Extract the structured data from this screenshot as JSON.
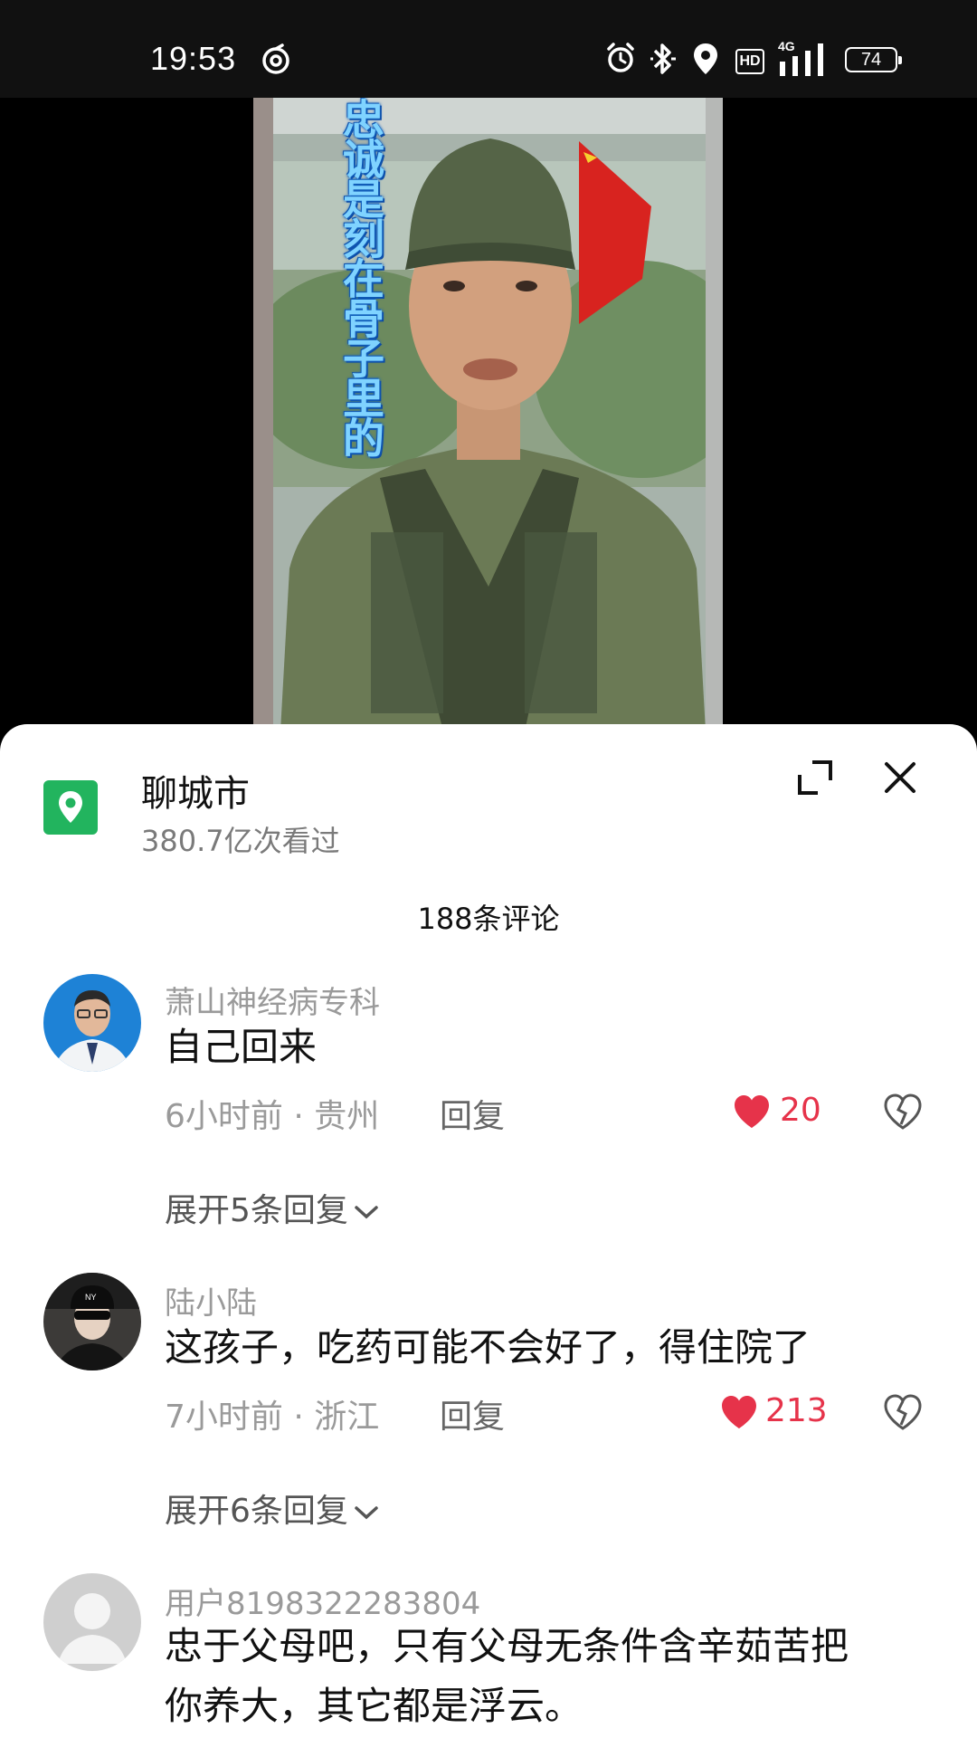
{
  "status": {
    "time": "19:53",
    "battery": "74",
    "hd": "HD",
    "network": "4G"
  },
  "video": {
    "overlay_text": "忠诚是刻在骨子里的"
  },
  "location": {
    "title": "聊城市",
    "views": "380.7亿次看过"
  },
  "comments_header": "188条评论",
  "comments": [
    {
      "user": "萧山神经病专科",
      "text": "自己回来",
      "time": "6小时前",
      "region": "贵州",
      "reply_label": "回复",
      "likes": "20",
      "expand": "展开5条回复"
    },
    {
      "user": "陆小陆",
      "text": "这孩子，吃药可能不会好了，得住院了",
      "time": "7小时前",
      "region": "浙江",
      "reply_label": "回复",
      "likes": "213",
      "expand": "展开6条回复"
    },
    {
      "user": "用户8198322283804",
      "text_line1": "忠于父母吧，只有父母无条件含辛茹苦把",
      "text_line2": "你养大，其它都是浮云。"
    }
  ],
  "colors": {
    "like_red": "#e6334a",
    "location_green": "#22b45e",
    "overlay_text_blue": "#7fd3ff"
  }
}
